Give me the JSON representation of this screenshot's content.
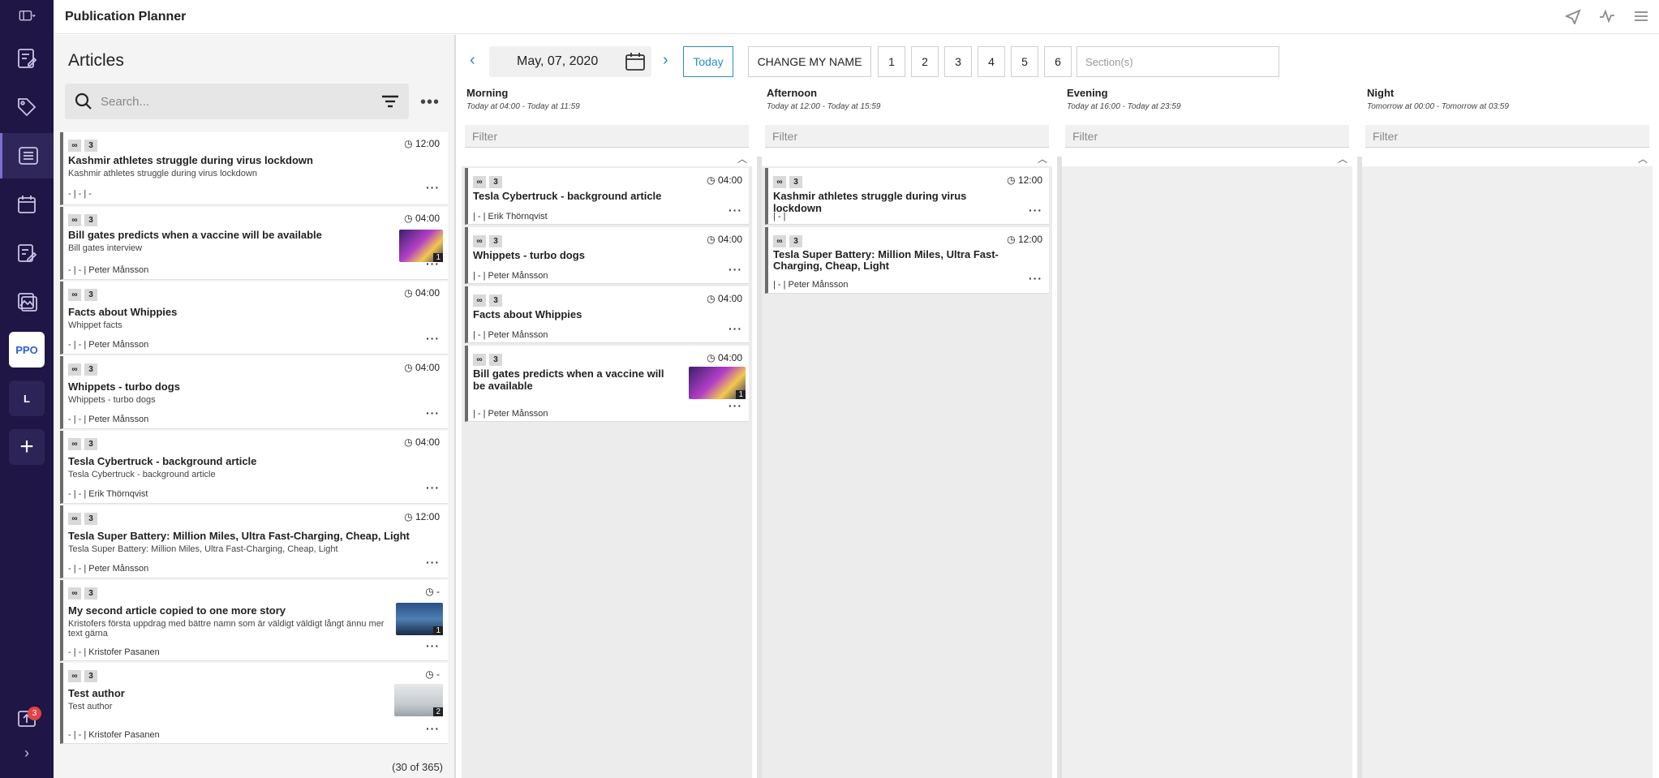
{
  "app": {
    "title": "Publication Planner"
  },
  "rail": {
    "ppo_label": "PPO",
    "l_label": "L",
    "notification_count": "3"
  },
  "articles": {
    "title": "Articles",
    "search_placeholder": "Search...",
    "count_text": "(30 of 365)",
    "items": [
      {
        "tag1": "∞",
        "tag2": "3",
        "time": "12:00",
        "headline": "Kashmir athletes struggle during virus lockdown",
        "sub": "Kashmir athletes struggle during virus lockdown",
        "meta": "- | - | -"
      },
      {
        "tag1": "∞",
        "tag2": "3",
        "time": "04:00",
        "headline": "Bill gates predicts when a vaccine will be available",
        "sub": "Bill gates interview",
        "meta": "- | - | Peter Månsson",
        "thumb_count": "1"
      },
      {
        "tag1": "∞",
        "tag2": "3",
        "time": "04:00",
        "headline": "Facts about Whippies",
        "sub": "Whippet facts",
        "meta": "- | - | Peter Månsson"
      },
      {
        "tag1": "∞",
        "tag2": "3",
        "time": "04:00",
        "headline": "Whippets - turbo dogs",
        "sub": "Whippets - turbo dogs",
        "meta": "- | - | Peter Månsson"
      },
      {
        "tag1": "∞",
        "tag2": "3",
        "time": "04:00",
        "headline": "Tesla Cybertruck - background article",
        "sub": "Tesla Cybertruck - background article",
        "meta": "- | - | Erik Thörnqvist"
      },
      {
        "tag1": "∞",
        "tag2": "3",
        "time": "12:00",
        "headline": "Tesla Super Battery: Million Miles, Ultra Fast-Charging, Cheap, Light",
        "sub": "Tesla Super Battery: Million Miles, Ultra Fast-Charging, Cheap, Light",
        "meta": "- | - | Peter Månsson"
      },
      {
        "tag1": "∞",
        "tag2": "3",
        "time": "-",
        "headline": "My second article copied to one more story",
        "sub": "Kristofers första uppdrag med bättre namn som är väldigt väldigt långt ännu mer text gärna",
        "meta": "- | - | Kristofer Pasanen",
        "thumb_count": "1"
      },
      {
        "tag1": "∞",
        "tag2": "3",
        "time": "-",
        "headline": "Test author",
        "sub": "Test author",
        "meta": "- | - | Kristofer Pasanen",
        "thumb_count": "2"
      }
    ]
  },
  "planner": {
    "date": "May, 07, 2020",
    "today_label": "Today",
    "change_name_label": "CHANGE MY NAME",
    "page_buttons": [
      "1",
      "2",
      "3",
      "4",
      "5",
      "6"
    ],
    "section_placeholder": "Section(s)",
    "filter_placeholder": "Filter",
    "columns": [
      {
        "name": "Morning",
        "range": "Today at 04:00 - Today at 11:59",
        "cards": [
          {
            "tag1": "∞",
            "tag2": "3",
            "time": "04:00",
            "headline": "Tesla Cybertruck - background article",
            "meta": "| - | Erik Thörnqvist"
          },
          {
            "tag1": "∞",
            "tag2": "3",
            "time": "04:00",
            "headline": "Whippets - turbo dogs",
            "meta": "| - | Peter Månsson"
          },
          {
            "tag1": "∞",
            "tag2": "3",
            "time": "04:00",
            "headline": "Facts about Whippies",
            "meta": "| - | Peter Månsson"
          },
          {
            "tag1": "∞",
            "tag2": "3",
            "time": "04:00",
            "headline": "Bill gates predicts when a vaccine will be available",
            "meta": "| - | Peter Månsson",
            "thumb_count": "1"
          }
        ]
      },
      {
        "name": "Afternoon",
        "range": "Today at 12:00 - Today at 15:59",
        "cards": [
          {
            "tag1": "∞",
            "tag2": "3",
            "time": "12:00",
            "headline": "Kashmir athletes struggle during virus lockdown",
            "meta": "| - |"
          },
          {
            "tag1": "∞",
            "tag2": "3",
            "time": "12:00",
            "headline": "Tesla Super Battery: Million Miles, Ultra Fast-Charging, Cheap, Light",
            "meta": "| - | Peter Månsson"
          }
        ]
      },
      {
        "name": "Evening",
        "range": "Today at 16:00 - Today at 23:59",
        "cards": []
      },
      {
        "name": "Night",
        "range": "Tomorrow at 00:00 - Tomorrow at 03:59",
        "cards": []
      }
    ]
  }
}
